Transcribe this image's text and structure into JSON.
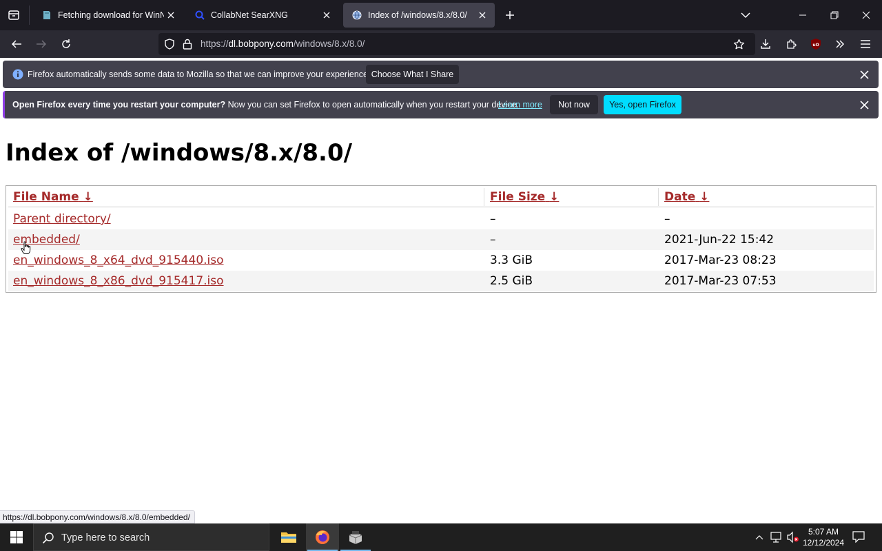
{
  "browser": {
    "tabs": [
      {
        "label": "Fetching download for WinNTSetup",
        "active": false
      },
      {
        "label": "CollabNet SearXNG",
        "active": false
      },
      {
        "label": "Index of /windows/8.x/8.0/",
        "active": true
      }
    ],
    "url": {
      "scheme": "https://",
      "host": "dl.bobpony.com",
      "path": "/windows/8.x/8.0/"
    }
  },
  "notifications": {
    "telemetry": {
      "message": "Firefox automatically sends some data to Mozilla so that we can improve your experience.",
      "button": "Choose What I Share"
    },
    "default_browser": {
      "bold": "Open Firefox every time you restart your computer?",
      "message": " Now you can set Firefox to open automatically when you restart your device.",
      "learn_more": "Learn more",
      "not_now": "Not now",
      "yes": "Yes, open Firefox"
    }
  },
  "page": {
    "title": "Index of /windows/8.x/8.0/",
    "columns": {
      "name": "File Name",
      "size": "File Size",
      "date": "Date",
      "sort_arrow": "↓"
    },
    "rows": [
      {
        "name": "Parent directory/",
        "size": "–",
        "date": "–"
      },
      {
        "name": "embedded/",
        "size": "–",
        "date": "2021-Jun-22 15:42"
      },
      {
        "name": "en_windows_8_x64_dvd_915440.iso",
        "size": "3.3 GiB",
        "date": "2017-Mar-23 08:23"
      },
      {
        "name": "en_windows_8_x86_dvd_915417.iso",
        "size": "2.5 GiB",
        "date": "2017-Mar-23 07:53"
      }
    ],
    "status_link": "https://dl.bobpony.com/windows/8.x/8.0/embedded/"
  },
  "taskbar": {
    "search_placeholder": "Type here to search",
    "time": "5:07 AM",
    "date": "12/12/2024"
  },
  "colors": {
    "link": "#a52a2a",
    "primary_button": "#00ddff",
    "tab_strip": "#1c1b22",
    "toolbar": "#2b2a33",
    "notification": "#42414d"
  }
}
